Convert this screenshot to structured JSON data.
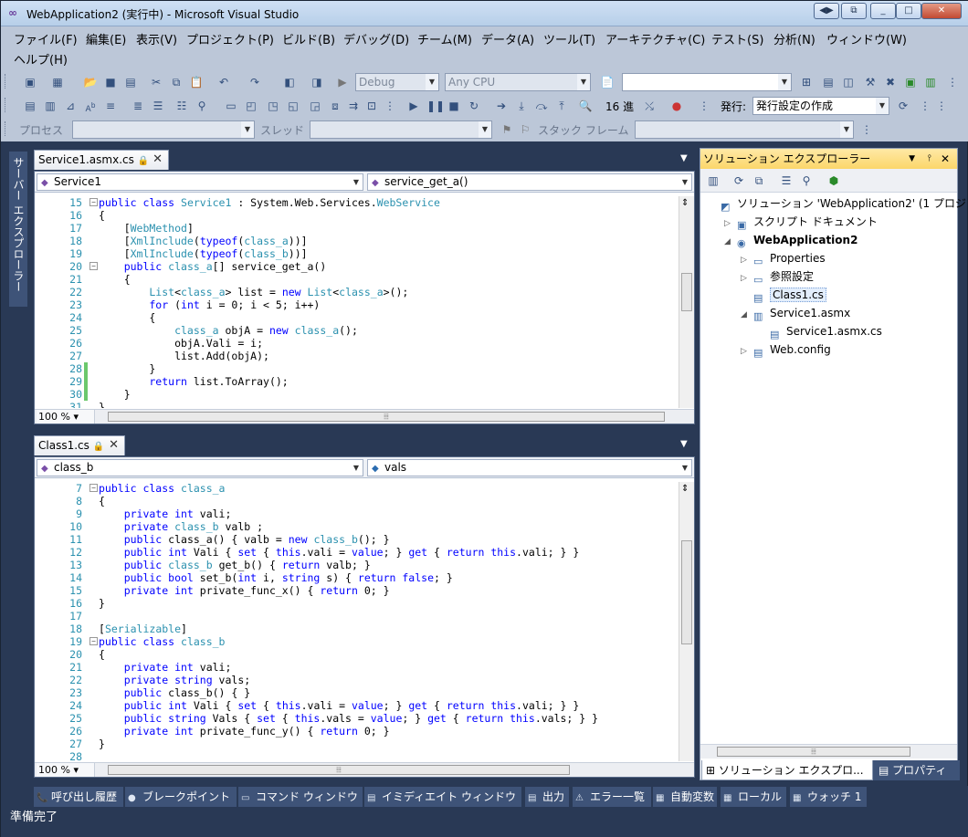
{
  "window": {
    "title": "WebApplication2 (実行中) - Microsoft Visual Studio"
  },
  "menu": {
    "items": [
      "ファイル(F)",
      "編集(E)",
      "表示(V)",
      "プロジェクト(P)",
      "ビルド(B)",
      "デバッグ(D)",
      "チーム(M)",
      "データ(A)",
      "ツール(T)",
      "アーキテクチャ(C)",
      "テスト(S)",
      "分析(N)",
      "ウィンドウ(W)",
      "ヘルプ(H)"
    ]
  },
  "toolbar": {
    "config": "Debug",
    "platform": "Any CPU",
    "hex_label": "16 進",
    "publish_label": "発行:",
    "publish_value": "発行設定の作成",
    "process_label": "プロセス",
    "thread_label": "スレッド",
    "stackframe_label": "スタック フレーム"
  },
  "side_tab": "サーバー エクスプローラー",
  "editor1": {
    "tab": "Service1.asmx.cs",
    "class_combo": "Service1",
    "member_combo": "service_get_a()",
    "zoom": "100 %",
    "lines": [
      {
        "n": "15",
        "fold": "-",
        "segs": [
          [
            "k",
            "public class "
          ],
          [
            "t",
            "Service1"
          ],
          [
            "p",
            " : System.Web.Services."
          ],
          [
            "t",
            "WebService"
          ]
        ]
      },
      {
        "n": "16",
        "segs": [
          [
            "p",
            "{"
          ]
        ]
      },
      {
        "n": "17",
        "segs": [
          [
            "p",
            "    ["
          ],
          [
            "t",
            "WebMethod"
          ],
          [
            "p",
            "]"
          ]
        ]
      },
      {
        "n": "18",
        "segs": [
          [
            "p",
            "    ["
          ],
          [
            "t",
            "XmlInclude"
          ],
          [
            "p",
            "("
          ],
          [
            "k",
            "typeof"
          ],
          [
            "p",
            "("
          ],
          [
            "t",
            "class_a"
          ],
          [
            "p",
            "))]"
          ]
        ]
      },
      {
        "n": "19",
        "segs": [
          [
            "p",
            "    ["
          ],
          [
            "t",
            "XmlInclude"
          ],
          [
            "p",
            "("
          ],
          [
            "k",
            "typeof"
          ],
          [
            "p",
            "("
          ],
          [
            "t",
            "class_b"
          ],
          [
            "p",
            "))]"
          ]
        ]
      },
      {
        "n": "20",
        "fold": "-",
        "segs": [
          [
            "k",
            "    public "
          ],
          [
            "t",
            "class_a"
          ],
          [
            "p",
            "[] service_get_a()"
          ]
        ]
      },
      {
        "n": "21",
        "segs": [
          [
            "p",
            "    {"
          ]
        ]
      },
      {
        "n": "22",
        "segs": [
          [
            "t",
            "        List"
          ],
          [
            "p",
            "<"
          ],
          [
            "t",
            "class_a"
          ],
          [
            "p",
            "> list = "
          ],
          [
            "k",
            "new "
          ],
          [
            "t",
            "List"
          ],
          [
            "p",
            "<"
          ],
          [
            "t",
            "class_a"
          ],
          [
            "p",
            ">();"
          ]
        ]
      },
      {
        "n": "23",
        "segs": [
          [
            "k",
            "        for "
          ],
          [
            "p",
            "("
          ],
          [
            "k",
            "int"
          ],
          [
            "p",
            " i = 0; i < 5; i++)"
          ]
        ]
      },
      {
        "n": "24",
        "segs": [
          [
            "p",
            "        {"
          ]
        ]
      },
      {
        "n": "25",
        "segs": [
          [
            "t",
            "            class_a"
          ],
          [
            "p",
            " objA = "
          ],
          [
            "k",
            "new "
          ],
          [
            "t",
            "class_a"
          ],
          [
            "p",
            "();"
          ]
        ]
      },
      {
        "n": "26",
        "segs": [
          [
            "p",
            "            objA.Vali = i;"
          ]
        ]
      },
      {
        "n": "27",
        "segs": [
          [
            "p",
            "            list.Add(objA);"
          ]
        ]
      },
      {
        "n": "28",
        "chg": true,
        "segs": [
          [
            "p",
            "        }"
          ]
        ]
      },
      {
        "n": "29",
        "chg": true,
        "segs": [
          [
            "k",
            "        return"
          ],
          [
            "p",
            " list.ToArray();"
          ]
        ]
      },
      {
        "n": "30",
        "chg": true,
        "segs": [
          [
            "p",
            "    }"
          ]
        ]
      },
      {
        "n": "31",
        "segs": [
          [
            "p",
            "}"
          ]
        ]
      }
    ]
  },
  "editor2": {
    "tab": "Class1.cs",
    "class_combo": "class_b",
    "member_combo": "vals",
    "zoom": "100 %",
    "lines": [
      {
        "n": "7",
        "fold": "-",
        "segs": [
          [
            "k",
            "public class "
          ],
          [
            "t",
            "class_a"
          ]
        ]
      },
      {
        "n": "8",
        "segs": [
          [
            "p",
            "{"
          ]
        ]
      },
      {
        "n": "9",
        "segs": [
          [
            "k",
            "    private int"
          ],
          [
            "p",
            " vali;"
          ]
        ]
      },
      {
        "n": "10",
        "segs": [
          [
            "k",
            "    private "
          ],
          [
            "t",
            "class_b"
          ],
          [
            "p",
            " valb ;"
          ]
        ]
      },
      {
        "n": "11",
        "segs": [
          [
            "k",
            "    public "
          ],
          [
            "p",
            "class_a() { valb = "
          ],
          [
            "k",
            "new "
          ],
          [
            "t",
            "class_b"
          ],
          [
            "p",
            "(); }"
          ]
        ]
      },
      {
        "n": "12",
        "segs": [
          [
            "k",
            "    public int"
          ],
          [
            "p",
            " Vali { "
          ],
          [
            "k",
            "set"
          ],
          [
            "p",
            " { "
          ],
          [
            "k",
            "this"
          ],
          [
            "p",
            ".vali = "
          ],
          [
            "k",
            "value"
          ],
          [
            "p",
            "; } "
          ],
          [
            "k",
            "get"
          ],
          [
            "p",
            " { "
          ],
          [
            "k",
            "return this"
          ],
          [
            "p",
            ".vali; } }"
          ]
        ]
      },
      {
        "n": "13",
        "segs": [
          [
            "k",
            "    public "
          ],
          [
            "t",
            "class_b"
          ],
          [
            "p",
            " get_b() { "
          ],
          [
            "k",
            "return"
          ],
          [
            "p",
            " valb; }"
          ]
        ]
      },
      {
        "n": "14",
        "segs": [
          [
            "k",
            "    public bool"
          ],
          [
            "p",
            " set_b("
          ],
          [
            "k",
            "int"
          ],
          [
            "p",
            " i, "
          ],
          [
            "k",
            "string"
          ],
          [
            "p",
            " s) { "
          ],
          [
            "k",
            "return false"
          ],
          [
            "p",
            "; }"
          ]
        ]
      },
      {
        "n": "15",
        "segs": [
          [
            "k",
            "    private int"
          ],
          [
            "p",
            " private_func_x() { "
          ],
          [
            "k",
            "return"
          ],
          [
            "p",
            " 0; }"
          ]
        ]
      },
      {
        "n": "16",
        "segs": [
          [
            "p",
            "}"
          ]
        ]
      },
      {
        "n": "17",
        "segs": [
          [
            "p",
            ""
          ]
        ]
      },
      {
        "n": "18",
        "segs": [
          [
            "p",
            "["
          ],
          [
            "t",
            "Serializable"
          ],
          [
            "p",
            "]"
          ]
        ]
      },
      {
        "n": "19",
        "fold": "-",
        "segs": [
          [
            "k",
            "public class "
          ],
          [
            "t",
            "class_b"
          ]
        ]
      },
      {
        "n": "20",
        "segs": [
          [
            "p",
            "{"
          ]
        ]
      },
      {
        "n": "21",
        "segs": [
          [
            "k",
            "    private int"
          ],
          [
            "p",
            " vali;"
          ]
        ]
      },
      {
        "n": "22",
        "segs": [
          [
            "k",
            "    private string"
          ],
          [
            "p",
            " vals;"
          ]
        ]
      },
      {
        "n": "23",
        "segs": [
          [
            "k",
            "    public "
          ],
          [
            "p",
            "class_b() { }"
          ]
        ]
      },
      {
        "n": "24",
        "segs": [
          [
            "k",
            "    public int"
          ],
          [
            "p",
            " Vali { "
          ],
          [
            "k",
            "set"
          ],
          [
            "p",
            " { "
          ],
          [
            "k",
            "this"
          ],
          [
            "p",
            ".vali = "
          ],
          [
            "k",
            "value"
          ],
          [
            "p",
            "; } "
          ],
          [
            "k",
            "get"
          ],
          [
            "p",
            " { "
          ],
          [
            "k",
            "return this"
          ],
          [
            "p",
            ".vali; } }"
          ]
        ]
      },
      {
        "n": "25",
        "segs": [
          [
            "k",
            "    public string"
          ],
          [
            "p",
            " Vals { "
          ],
          [
            "k",
            "set"
          ],
          [
            "p",
            " { "
          ],
          [
            "k",
            "this"
          ],
          [
            "p",
            ".vals = "
          ],
          [
            "k",
            "value"
          ],
          [
            "p",
            "; } "
          ],
          [
            "k",
            "get"
          ],
          [
            "p",
            " { "
          ],
          [
            "k",
            "return this"
          ],
          [
            "p",
            ".vals; } }"
          ]
        ]
      },
      {
        "n": "26",
        "segs": [
          [
            "k",
            "    private int"
          ],
          [
            "p",
            " private_func_y() { "
          ],
          [
            "k",
            "return"
          ],
          [
            "p",
            " 0; }"
          ]
        ]
      },
      {
        "n": "27",
        "segs": [
          [
            "p",
            "}"
          ]
        ]
      },
      {
        "n": "28",
        "segs": [
          [
            "p",
            ""
          ]
        ]
      }
    ]
  },
  "solution_explorer": {
    "title": "ソリューション エクスプローラー",
    "pin": "📌",
    "nodes": [
      {
        "label": "ソリューション 'WebApplication2' (1 プロジ",
        "indent": 0,
        "exp": "",
        "icon": "sln"
      },
      {
        "label": "スクリプト ドキュメント",
        "indent": 1,
        "exp": "▷",
        "icon": "scr"
      },
      {
        "label": "WebApplication2",
        "indent": 1,
        "exp": "◢",
        "icon": "web",
        "bold": true
      },
      {
        "label": "Properties",
        "indent": 2,
        "exp": "▷",
        "icon": "prop"
      },
      {
        "label": "参照設定",
        "indent": 2,
        "exp": "▷",
        "icon": "ref"
      },
      {
        "label": "Class1.cs",
        "indent": 2,
        "exp": "",
        "icon": "cs",
        "selected": true
      },
      {
        "label": "Service1.asmx",
        "indent": 2,
        "exp": "◢",
        "icon": "asmx"
      },
      {
        "label": "Service1.asmx.cs",
        "indent": 3,
        "exp": "",
        "icon": "cs"
      },
      {
        "label": "Web.config",
        "indent": 2,
        "exp": "▷",
        "icon": "cfg"
      }
    ],
    "bottom_tabs": [
      "ソリューション エクスプロ...",
      "プロパティ"
    ]
  },
  "bottom_tabs": [
    "呼び出し履歴",
    "ブレークポイント",
    "コマンド ウィンドウ",
    "イミディエイト ウィンドウ",
    "出力",
    "エラー一覧",
    "自動変数",
    "ローカル",
    "ウォッチ 1"
  ],
  "status": "準備完了"
}
